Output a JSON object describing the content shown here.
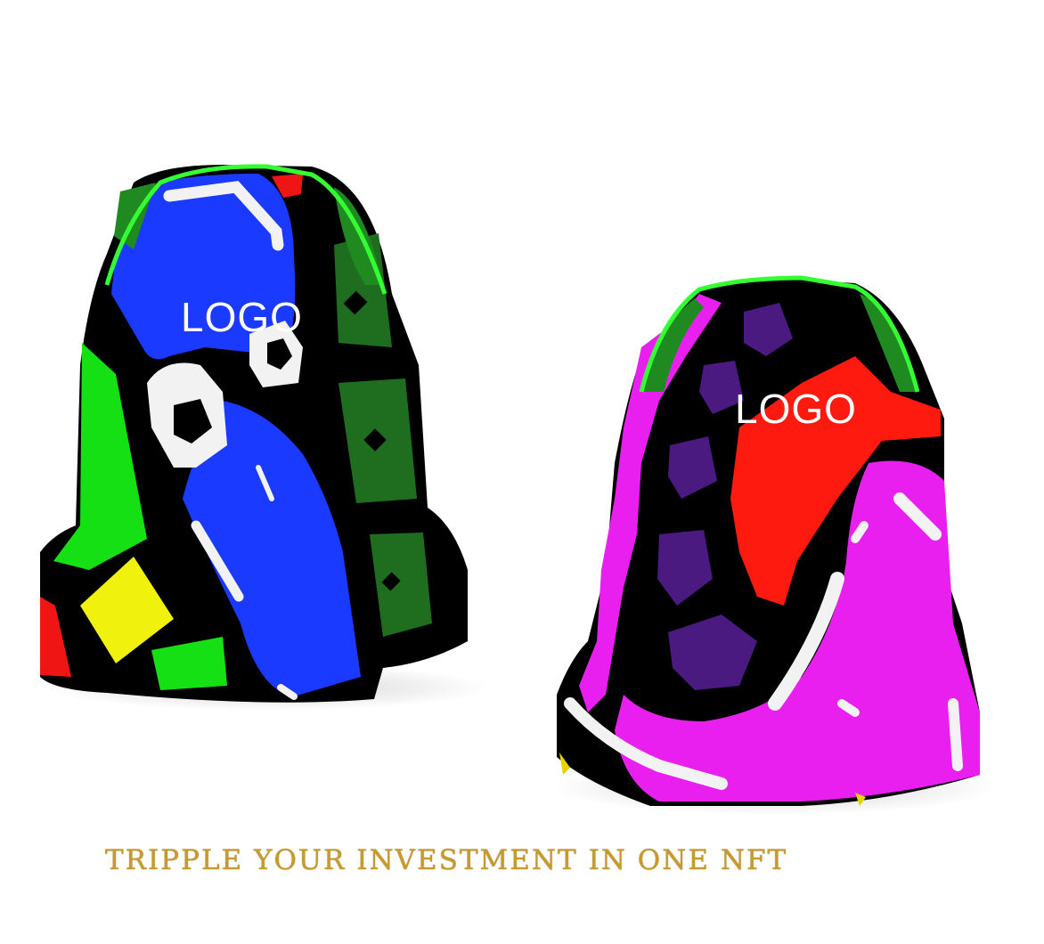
{
  "products": [
    {
      "name": "Left sneaker",
      "logo_text": "LOGO",
      "colors": {
        "base": "#1a3bff",
        "accent_green": "#14e014",
        "dark_green": "#1f6e1f",
        "yellow": "#f1f10e",
        "red": "#f01515",
        "outline": "#000000",
        "collar": "#33ff33"
      }
    },
    {
      "name": "Right sneaker",
      "logo_text": "LOGO",
      "colors": {
        "base": "#e81fee",
        "purple": "#4a1a80",
        "red": "#ff1a10",
        "dark_green": "#1f8a1f",
        "outline": "#000000",
        "collar": "#33ff33"
      }
    }
  ],
  "tagline": "TRIPPLE YOUR INVESTMENT IN ONE NFT"
}
